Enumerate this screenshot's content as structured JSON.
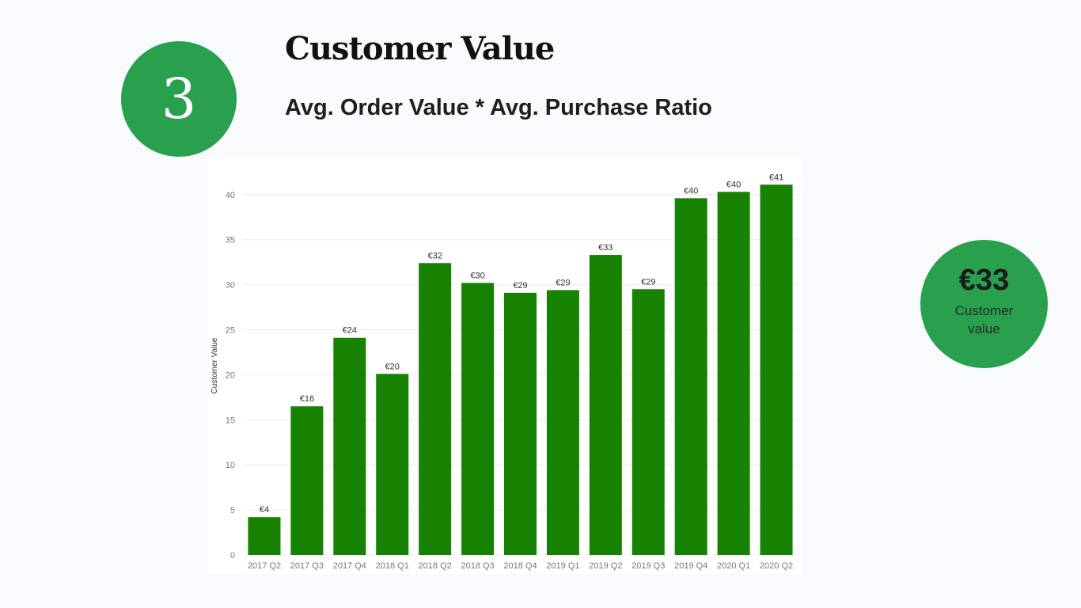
{
  "header": {
    "step_number": "3",
    "title": "Customer Value",
    "subtitle": "Avg. Order Value * Avg. Purchase Ratio"
  },
  "kpi": {
    "value": "€33",
    "label": "Customer value"
  },
  "colors": {
    "accent": "#28a04e",
    "bar": "#168200",
    "background": "#f8fafe"
  },
  "chart_data": {
    "type": "bar",
    "title": "",
    "xlabel": "",
    "ylabel": "Customer Value",
    "categories": [
      "2017 Q2",
      "2017 Q3",
      "2017 Q4",
      "2018 Q1",
      "2018 Q2",
      "2018 Q3",
      "2018 Q4",
      "2019 Q1",
      "2019 Q2",
      "2019 Q3",
      "2019 Q4",
      "2020 Q1",
      "2020 Q2"
    ],
    "values": [
      4.2,
      16.5,
      24.1,
      20.1,
      32.4,
      30.2,
      29.1,
      29.4,
      33.3,
      29.5,
      39.6,
      40.3,
      41.1
    ],
    "data_labels": [
      "€4",
      "€16",
      "€24",
      "€20",
      "€32",
      "€30",
      "€29",
      "€29",
      "€33",
      "€29",
      "€40",
      "€40",
      "€41"
    ],
    "yticks": [
      0,
      5,
      10,
      15,
      20,
      25,
      30,
      35,
      40
    ],
    "ylim": [
      0,
      43.3
    ],
    "grid": true,
    "legend": "none"
  }
}
